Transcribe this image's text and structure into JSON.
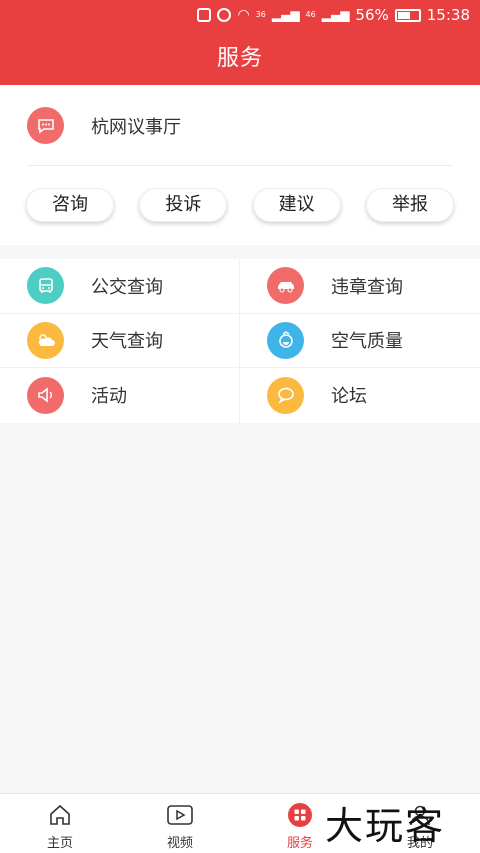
{
  "status_bar": {
    "battery": "56%",
    "time": "15:38",
    "net1": "36",
    "net2": "46"
  },
  "header": {
    "title": "服务"
  },
  "hall": {
    "label": "杭网议事厅",
    "icon": "chat-bubble-icon",
    "color": "#f26b6b"
  },
  "pills": [
    "咨询",
    "投诉",
    "建议",
    "举报"
  ],
  "services": [
    {
      "label": "公交查询",
      "icon": "bus-icon",
      "color": "#4ecdc4"
    },
    {
      "label": "违章查询",
      "icon": "car-icon",
      "color": "#f26b6b"
    },
    {
      "label": "天气查询",
      "icon": "weather-icon",
      "color": "#fbb940"
    },
    {
      "label": "空气质量",
      "icon": "air-quality-icon",
      "color": "#3fb4e8"
    },
    {
      "label": "活动",
      "icon": "megaphone-icon",
      "color": "#f26b6b"
    },
    {
      "label": "论坛",
      "icon": "forum-icon",
      "color": "#fbb940"
    }
  ],
  "bottom_nav": [
    {
      "label": "主页",
      "icon": "home-icon"
    },
    {
      "label": "视频",
      "icon": "video-icon"
    },
    {
      "label": "服务",
      "icon": "services-icon",
      "active": true
    },
    {
      "label": "我的",
      "icon": "profile-icon"
    }
  ],
  "watermark": "大玩客",
  "colors": {
    "primary": "#e84040"
  }
}
